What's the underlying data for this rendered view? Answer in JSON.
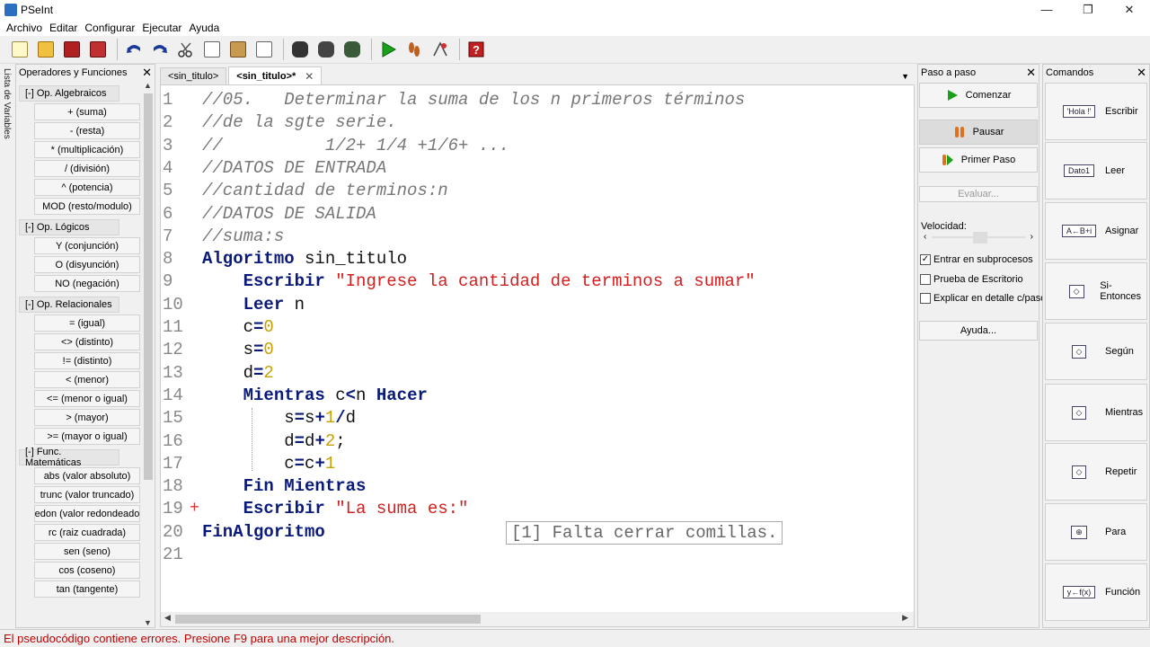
{
  "window": {
    "title": "PSeInt",
    "minimize": "—",
    "maximize": "❐",
    "close": "✕"
  },
  "menu": [
    "Archivo",
    "Editar",
    "Configurar",
    "Ejecutar",
    "Ayuda"
  ],
  "colors": {
    "keyword": "#0a1a7a",
    "string": "#d02020",
    "number": "#c8a000",
    "comment": "#777777",
    "error": "#c00000"
  },
  "vartab": {
    "label": "Lista de Variables",
    "symbols": "*+=<"
  },
  "left_panel": {
    "title": "Operadores y Funciones",
    "close": "✕",
    "categories": [
      {
        "label": "[-]  Op. Algebraicos",
        "items": [
          "+ (suma)",
          "- (resta)",
          "* (multiplicación)",
          "/ (división)",
          "^ (potencia)",
          "MOD (resto/modulo)"
        ]
      },
      {
        "label": "[-]  Op. Lógicos",
        "items": [
          "Y (conjunción)",
          "O (disyunción)",
          "NO (negación)"
        ]
      },
      {
        "label": "[-]  Op. Relacionales",
        "items": [
          "= (igual)",
          "<> (distinto)",
          "!= (distinto)",
          "< (menor)",
          "<= (menor o igual)",
          "> (mayor)",
          ">= (mayor o igual)"
        ]
      },
      {
        "label": "[-]  Func. Matemáticas",
        "items": [
          "abs (valor absoluto)",
          "trunc (valor truncado)",
          "redon (valor redondeado)",
          "rc (raiz cuadrada)",
          "sen (seno)",
          "cos (coseno)",
          "tan (tangente)"
        ]
      }
    ]
  },
  "tabs": [
    {
      "label": "<sin_titulo>",
      "active": false
    },
    {
      "label": "<sin_titulo>*",
      "active": true,
      "close": "✕"
    }
  ],
  "editor": {
    "lines": [
      {
        "n": "1",
        "parts": [
          [
            "cm",
            "//05.   Determinar la suma de los n primeros términos"
          ]
        ]
      },
      {
        "n": "2",
        "parts": [
          [
            "cm",
            "//de la sgte serie."
          ]
        ]
      },
      {
        "n": "3",
        "parts": [
          [
            "cm",
            "//          1/2+ 1/4 +1/6+ ..."
          ]
        ]
      },
      {
        "n": "4",
        "parts": [
          [
            "cm",
            "//DATOS DE ENTRADA"
          ]
        ]
      },
      {
        "n": "5",
        "parts": [
          [
            "cm",
            "//cantidad de terminos:n"
          ]
        ]
      },
      {
        "n": "6",
        "parts": [
          [
            "cm",
            "//DATOS DE SALIDA"
          ]
        ]
      },
      {
        "n": "7",
        "parts": [
          [
            "cm",
            "//suma:s"
          ]
        ]
      },
      {
        "n": "8",
        "parts": [
          [
            "kw",
            "Algoritmo"
          ],
          [
            "id",
            " sin_titulo"
          ]
        ]
      },
      {
        "n": "9",
        "parts": [
          [
            "id",
            "    "
          ],
          [
            "kw",
            "Escribir"
          ],
          [
            "id",
            " "
          ],
          [
            "str",
            "\"Ingrese la cantidad de terminos a sumar\""
          ]
        ]
      },
      {
        "n": "10",
        "parts": [
          [
            "id",
            "    "
          ],
          [
            "kw",
            "Leer"
          ],
          [
            "id",
            " n"
          ]
        ]
      },
      {
        "n": "11",
        "parts": [
          [
            "id",
            "    c"
          ],
          [
            "op2",
            "="
          ],
          [
            "num",
            "0"
          ]
        ]
      },
      {
        "n": "12",
        "parts": [
          [
            "id",
            "    s"
          ],
          [
            "op2",
            "="
          ],
          [
            "num",
            "0"
          ]
        ]
      },
      {
        "n": "13",
        "parts": [
          [
            "id",
            "    d"
          ],
          [
            "op2",
            "="
          ],
          [
            "num",
            "2"
          ]
        ]
      },
      {
        "n": "14",
        "parts": [
          [
            "id",
            "    "
          ],
          [
            "kw",
            "Mientras"
          ],
          [
            "id",
            " c"
          ],
          [
            "op2",
            "<"
          ],
          [
            "id",
            "n "
          ],
          [
            "kw",
            "Hacer"
          ]
        ]
      },
      {
        "n": "15",
        "parts": [
          [
            "id",
            "        s"
          ],
          [
            "op2",
            "="
          ],
          [
            "id",
            "s"
          ],
          [
            "op2",
            "+"
          ],
          [
            "num",
            "1"
          ],
          [
            "op2",
            "/"
          ],
          [
            "id",
            "d"
          ]
        ]
      },
      {
        "n": "16",
        "parts": [
          [
            "id",
            "        d"
          ],
          [
            "op2",
            "="
          ],
          [
            "id",
            "d"
          ],
          [
            "op2",
            "+"
          ],
          [
            "num",
            "2"
          ],
          [
            "id",
            ";"
          ]
        ]
      },
      {
        "n": "17",
        "parts": [
          [
            "id",
            "        c"
          ],
          [
            "op2",
            "="
          ],
          [
            "id",
            "c"
          ],
          [
            "op2",
            "+"
          ],
          [
            "num",
            "1"
          ]
        ]
      },
      {
        "n": "18",
        "parts": [
          [
            "id",
            "    "
          ],
          [
            "kw",
            "Fin Mientras"
          ]
        ]
      },
      {
        "n": "19",
        "mark": "+",
        "parts": [
          [
            "id",
            "    "
          ],
          [
            "kw",
            "Escribir"
          ],
          [
            "id",
            " "
          ],
          [
            "str",
            "\"La suma es:\""
          ]
        ]
      },
      {
        "n": "20",
        "parts": [
          [
            "kw",
            "FinAlgoritmo"
          ]
        ]
      },
      {
        "n": "21",
        "parts": []
      }
    ],
    "error_tooltip": "[1] Falta cerrar comillas."
  },
  "step_panel": {
    "title": "Paso a paso",
    "close": "✕",
    "comenzar": "Comenzar",
    "pausar": "Pausar",
    "primer_paso": "Primer Paso",
    "evaluar": "Evaluar...",
    "velocidad": "Velocidad:",
    "speed_level": 0.5,
    "checks": [
      {
        "label": "Entrar en subprocesos",
        "checked": true
      },
      {
        "label": "Prueba de Escritorio",
        "checked": false
      },
      {
        "label": "Explicar en detalle c/paso",
        "checked": false
      }
    ],
    "ayuda": "Ayuda..."
  },
  "commands_panel": {
    "title": "Comandos",
    "close": "✕",
    "items": [
      {
        "label": "Escribir",
        "icon": "escribir-icon",
        "glyph": "'Hola !'"
      },
      {
        "label": "Leer",
        "icon": "leer-icon",
        "glyph": "Dato1"
      },
      {
        "label": "Asignar",
        "icon": "asignar-icon",
        "glyph": "A←B+i"
      },
      {
        "label": "Si-Entonces",
        "icon": "si-entonces-icon",
        "glyph": "◇"
      },
      {
        "label": "Según",
        "icon": "segun-icon",
        "glyph": "◇"
      },
      {
        "label": "Mientras",
        "icon": "mientras-icon",
        "glyph": "◇"
      },
      {
        "label": "Repetir",
        "icon": "repetir-icon",
        "glyph": "◇"
      },
      {
        "label": "Para",
        "icon": "para-icon",
        "glyph": "⊕"
      },
      {
        "label": "Función",
        "icon": "funcion-icon",
        "glyph": "y←f(x)"
      }
    ]
  },
  "status": "El pseudocódigo contiene errores. Presione F9 para una mejor descripción."
}
